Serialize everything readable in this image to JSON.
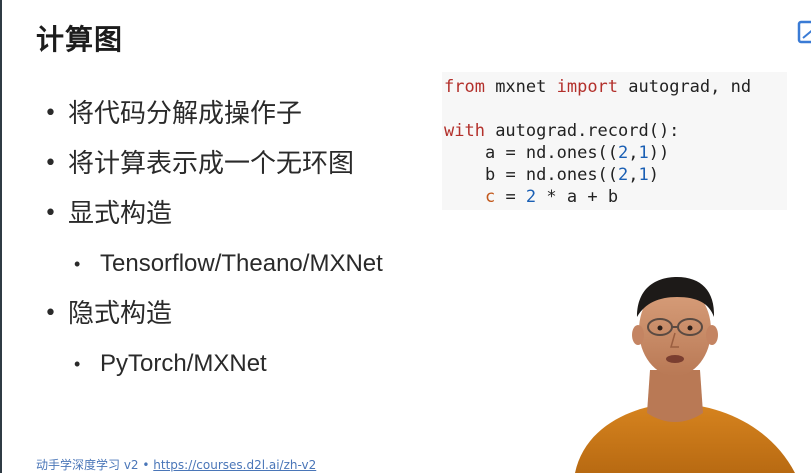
{
  "slide": {
    "title": "计算图",
    "bullets": [
      {
        "text": "将代码分解成操作子",
        "sub": []
      },
      {
        "text": "将计算表示成一个无环图",
        "sub": []
      },
      {
        "text": "显式构造",
        "sub": [
          "Tensorflow/Theano/MXNet"
        ]
      },
      {
        "text": "隐式构造",
        "sub": [
          "PyTorch/MXNet"
        ]
      }
    ],
    "bullet_glyph": "•"
  },
  "code": {
    "import_line": {
      "kw_from": "from",
      "mod": " mxnet ",
      "kw_import": "import",
      "rest": " autograd, nd"
    },
    "with_line": {
      "kw_with": "with",
      "rest": " autograd.record():"
    },
    "line_a": {
      "indent": "    ",
      "var": "a",
      "mid": " = nd.ones((",
      "n1": "2",
      "comma": ",",
      "n2": "1",
      "end": "))"
    },
    "line_b": {
      "indent": "    ",
      "var": "b",
      "mid": " = nd.ones((",
      "n1": "2",
      "comma": ",",
      "n2": "1",
      "end": ")"
    },
    "line_c": {
      "indent": "    ",
      "var": "c",
      "eq": " = ",
      "n": "2",
      "rest": " * a + b"
    }
  },
  "footer": {
    "course": "动手学深度学习 v2 • ",
    "url": "https://courses.d2l.ai/zh-v2"
  },
  "colors": {
    "keyword": "#b3302b",
    "number": "#1a5fb4",
    "variable": "#c2581c",
    "footer_link": "#4a76b8"
  },
  "icons": {
    "corner": "presentation-icon"
  }
}
